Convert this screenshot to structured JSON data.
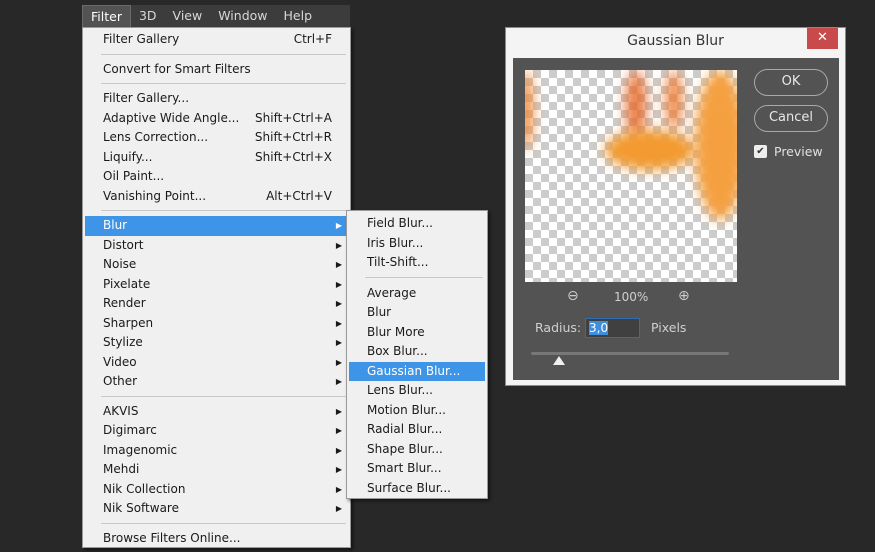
{
  "menubar": [
    "Filter",
    "3D",
    "View",
    "Window",
    "Help"
  ],
  "main_menu": [
    {
      "label": "Filter Gallery",
      "shortcut": "Ctrl+F"
    },
    {
      "sep": true
    },
    {
      "label": "Convert for Smart Filters"
    },
    {
      "sep": true
    },
    {
      "label": "Filter Gallery..."
    },
    {
      "label": "Adaptive Wide Angle...",
      "shortcut": "Shift+Ctrl+A"
    },
    {
      "label": "Lens Correction...",
      "shortcut": "Shift+Ctrl+R"
    },
    {
      "label": "Liquify...",
      "shortcut": "Shift+Ctrl+X"
    },
    {
      "label": "Oil Paint..."
    },
    {
      "label": "Vanishing Point...",
      "shortcut": "Alt+Ctrl+V"
    },
    {
      "sep": true
    },
    {
      "label": "Blur",
      "sub": true,
      "hl": true
    },
    {
      "label": "Distort",
      "sub": true
    },
    {
      "label": "Noise",
      "sub": true
    },
    {
      "label": "Pixelate",
      "sub": true
    },
    {
      "label": "Render",
      "sub": true
    },
    {
      "label": "Sharpen",
      "sub": true
    },
    {
      "label": "Stylize",
      "sub": true
    },
    {
      "label": "Video",
      "sub": true
    },
    {
      "label": "Other",
      "sub": true
    },
    {
      "sep": true
    },
    {
      "label": "AKVIS",
      "sub": true
    },
    {
      "label": "Digimarc",
      "sub": true
    },
    {
      "label": "Imagenomic",
      "sub": true
    },
    {
      "label": "Mehdi",
      "sub": true
    },
    {
      "label": "Nik Collection",
      "sub": true
    },
    {
      "label": "Nik Software",
      "sub": true
    },
    {
      "sep": true
    },
    {
      "label": "Browse Filters Online..."
    }
  ],
  "blur_submenu": [
    {
      "label": "Field Blur..."
    },
    {
      "label": "Iris Blur..."
    },
    {
      "label": "Tilt-Shift..."
    },
    {
      "sep": true
    },
    {
      "label": "Average"
    },
    {
      "label": "Blur"
    },
    {
      "label": "Blur More"
    },
    {
      "label": "Box Blur..."
    },
    {
      "label": "Gaussian Blur...",
      "hl": true
    },
    {
      "label": "Lens Blur..."
    },
    {
      "label": "Motion Blur..."
    },
    {
      "label": "Radial Blur..."
    },
    {
      "label": "Shape Blur..."
    },
    {
      "label": "Smart Blur..."
    },
    {
      "label": "Surface Blur..."
    }
  ],
  "dialog": {
    "title": "Gaussian Blur",
    "close": "✕",
    "ok": "OK",
    "cancel": "Cancel",
    "preview_label": "Preview",
    "preview_checked": true,
    "zoom_level": "100%",
    "zoom_out": "⊖",
    "zoom_in": "⊕",
    "radius_label": "Radius:",
    "radius_value": "3,0",
    "radius_unit": "Pixels",
    "radius_slider_fraction": 0.14
  }
}
